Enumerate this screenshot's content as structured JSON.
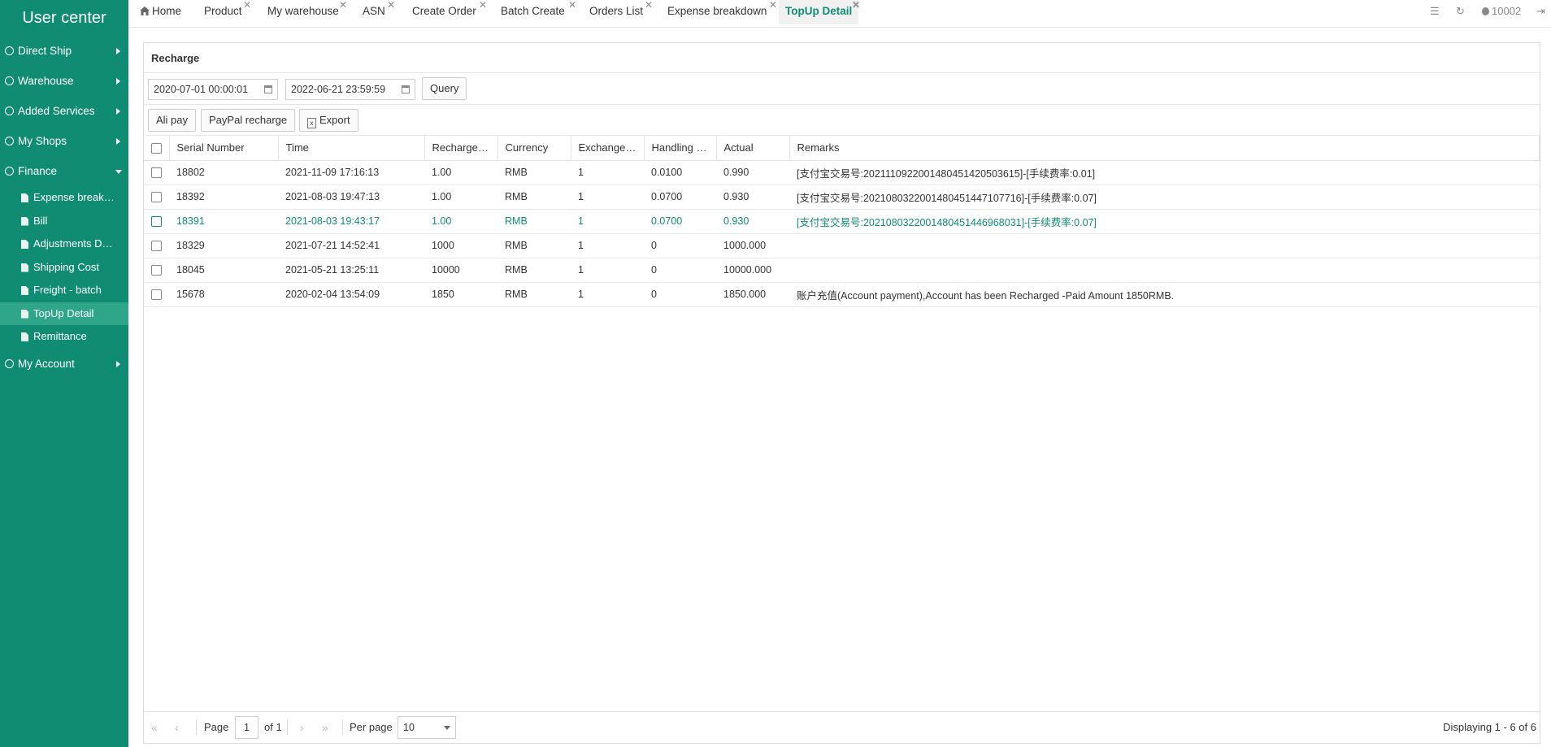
{
  "sidebar": {
    "brand": "User center",
    "menu": [
      {
        "label": "Direct Ship"
      },
      {
        "label": "Warehouse"
      },
      {
        "label": "Added Services"
      },
      {
        "label": "My Shops"
      },
      {
        "label": "Finance"
      }
    ],
    "finance_items": [
      {
        "label": "Expense breakdown"
      },
      {
        "label": "Bill"
      },
      {
        "label": "Adjustments Detail"
      },
      {
        "label": "Shipping Cost"
      },
      {
        "label": "Freight - batch"
      },
      {
        "label": "TopUp Detail"
      },
      {
        "label": "Remittance"
      }
    ],
    "account": {
      "label": "My Account"
    }
  },
  "tabs": [
    {
      "label": "Home"
    },
    {
      "label": "Product"
    },
    {
      "label": "My warehouse"
    },
    {
      "label": "ASN"
    },
    {
      "label": "Create Order"
    },
    {
      "label": "Batch Create"
    },
    {
      "label": "Orders List"
    },
    {
      "label": "Expense breakdown"
    },
    {
      "label": "TopUp Detail"
    }
  ],
  "topbar": {
    "user": "10002"
  },
  "panel": {
    "title": "Recharge"
  },
  "filter": {
    "start_date": "2020-07-01 00:00:01",
    "end_date": "2022-06-21 23:59:59",
    "query_label": "Query"
  },
  "toolbar": {
    "alipay_label": "Ali pay",
    "paypal_label": "PayPal recharge",
    "export_label": "Export"
  },
  "table": {
    "headers": [
      "Serial Number",
      "Time",
      "Recharge Amount",
      "Currency",
      "Exchange Rate",
      "Handling Fee",
      "Actual",
      "Remarks"
    ],
    "rows": [
      [
        "18802",
        "2021-11-09 17:16:13",
        "1.00",
        "RMB",
        "1",
        "0.0100",
        "0.990",
        "[支付宝交易号:2021110922001480451420503615]-[手续费率:0.01]"
      ],
      [
        "18392",
        "2021-08-03 19:47:13",
        "1.00",
        "RMB",
        "1",
        "0.0700",
        "0.930",
        "[支付宝交易号:2021080322001480451447107716]-[手续费率:0.07]"
      ],
      [
        "18391",
        "2021-08-03 19:43:17",
        "1.00",
        "RMB",
        "1",
        "0.0700",
        "0.930",
        "[支付宝交易号:2021080322001480451446968031]-[手续费率:0.07]"
      ],
      [
        "18329",
        "2021-07-21 14:52:41",
        "1000",
        "RMB",
        "1",
        "0",
        "1000.000",
        ""
      ],
      [
        "18045",
        "2021-05-21 13:25:11",
        "10000",
        "RMB",
        "1",
        "0",
        "10000.000",
        ""
      ],
      [
        "15678",
        "2020-02-04 13:54:09",
        "1850",
        "RMB",
        "1",
        "0",
        "1850.000",
        "账户充值(Account payment),Account has been Recharged -Paid Amount 1850RMB."
      ]
    ]
  },
  "pager": {
    "page_label": "Page",
    "page_value": "1",
    "of_label": "of 1",
    "per_page_label": "Per page",
    "per_page_value": "10",
    "display_text": "Displaying 1 - 6 of 6"
  },
  "colors": {
    "accent": "#0f8c72",
    "active_sub": "#2fa58a"
  }
}
